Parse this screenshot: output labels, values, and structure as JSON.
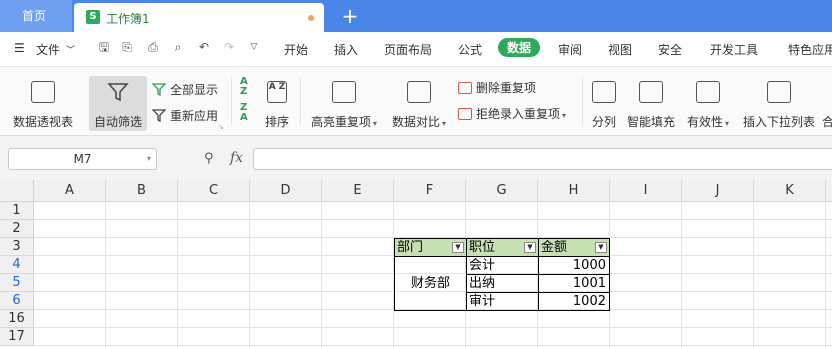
{
  "tabs": {
    "home": "首页",
    "doc_icon": "S",
    "doc_name": "工作簿1",
    "new_tab": "+"
  },
  "menu": {
    "file": "文件",
    "items": [
      "开始",
      "插入",
      "页面布局",
      "公式",
      "数据",
      "审阅",
      "视图",
      "安全",
      "开发工具",
      "特色应用"
    ],
    "active": "数据"
  },
  "ribbon": {
    "pivot": "数据透视表",
    "autofilter": "自动筛选",
    "show_all": "全部显示",
    "reapply": "重新应用",
    "sort_asc_icon": "AZ",
    "sort": "排序",
    "highlight_dup": "高亮重复项",
    "compare": "数据对比",
    "remove_dup": "删除重复项",
    "reject_dup": "拒绝录入重复项",
    "split": "分列",
    "smart_fill": "智能填充",
    "validity": "有效性",
    "insert_dropdown": "插入下拉列表",
    "merge_calc": "合"
  },
  "formula_bar": {
    "name_box": "M7",
    "fx": "fx",
    "formula": ""
  },
  "grid": {
    "columns": [
      "A",
      "B",
      "C",
      "D",
      "E",
      "F",
      "G",
      "H",
      "I",
      "J",
      "K"
    ],
    "rows": [
      "1",
      "2",
      "3",
      "4",
      "5",
      "6",
      "16",
      "17"
    ],
    "highlighted_rows": [
      "4",
      "5",
      "6"
    ],
    "header_fill": "#c6e0b4",
    "table": {
      "headers": [
        "部门",
        "职位",
        "金额"
      ],
      "department": "财务部",
      "positions": [
        "会计",
        "出纳",
        "审计"
      ],
      "amounts": [
        "1000",
        "1001",
        "1002"
      ]
    }
  }
}
